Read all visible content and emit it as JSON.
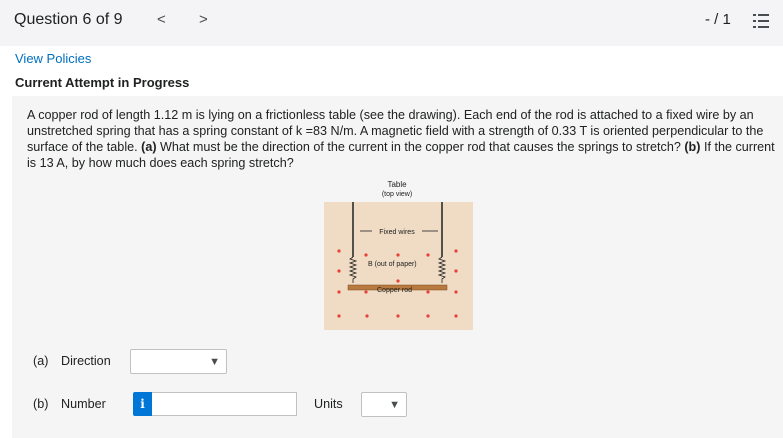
{
  "header": {
    "question_label": "Question 6 of 9",
    "prev_glyph": "<",
    "next_glyph": ">",
    "score": "- / 1",
    "list_icon": "question-list-icon"
  },
  "links": {
    "view_policies": "View Policies"
  },
  "status": {
    "attempt": "Current Attempt in Progress"
  },
  "question": {
    "line1": "A copper rod of length 1.12 m is lying on a frictionless table (see the drawing). Each end of the rod is attached to a fixed wire by an",
    "line2": "unstretched spring that has a spring constant of k =83 N/m. A magnetic field with a strength of 0.33 T is oriented perpendicular to the",
    "line3_pre": "surface of the table. ",
    "part_a_marker": "(a)",
    "line3_mid": " What must be the direction of the current in the copper rod that causes the springs to stretch? ",
    "part_b_marker": "(b)",
    "line3_post": " If the current",
    "line4": "is 13 A, by how much does each spring stretch?"
  },
  "figure": {
    "title_line1": "Table",
    "title_line2": "(top view)",
    "fixed_wires": "Fixed wires",
    "field_label": "B (out of paper)",
    "rod_label": "Copper rod",
    "table_color": "#f0dcc4",
    "dot_color": "#e8403a"
  },
  "answers": {
    "a_label": "(a)",
    "a_text": "Direction",
    "b_label": "(b)",
    "b_text": "Number",
    "units_label": "Units",
    "info_glyph": "i",
    "direction_value": "",
    "number_value": "",
    "units_value": ""
  },
  "colors": {
    "link": "#006fbf",
    "accent": "#0076d6",
    "topbar": "#f4f4f6"
  }
}
